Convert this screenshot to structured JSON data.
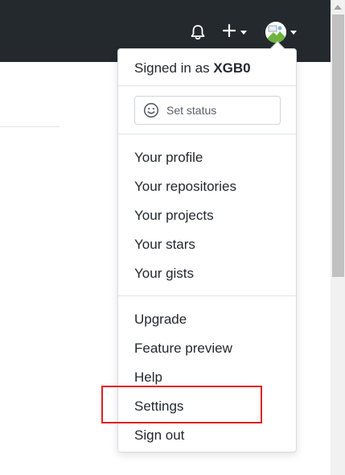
{
  "header": {
    "notifications_icon": "bell-icon",
    "create_icon": "plus-icon",
    "avatar_icon": "user-avatar"
  },
  "dropdown": {
    "signed_in_prefix": "Signed in as",
    "username": "XGB0",
    "set_status": {
      "icon": "smiley-icon",
      "label": "Set status"
    },
    "profile_section": [
      {
        "label": "Your profile"
      },
      {
        "label": "Your repositories"
      },
      {
        "label": "Your projects"
      },
      {
        "label": "Your stars"
      },
      {
        "label": "Your gists"
      }
    ],
    "account_section": [
      {
        "label": "Upgrade"
      },
      {
        "label": "Feature preview"
      },
      {
        "label": "Help"
      },
      {
        "label": "Settings"
      },
      {
        "label": "Sign out"
      }
    ]
  },
  "highlight": {
    "target": "Settings",
    "color": "#e02020"
  }
}
